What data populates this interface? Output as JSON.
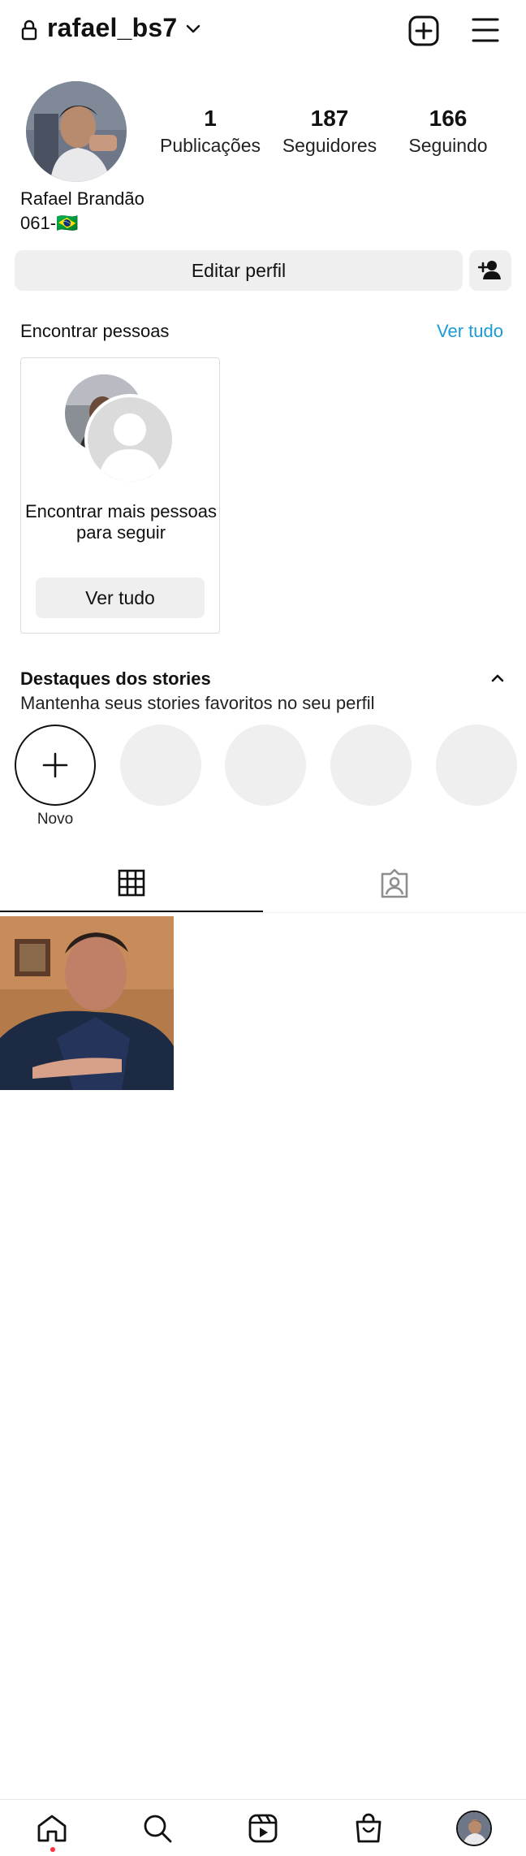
{
  "header": {
    "username": "rafael_bs7",
    "icons": [
      "lock-icon",
      "chevron-down-icon",
      "new-post-icon",
      "menu-icon"
    ]
  },
  "profile": {
    "stats": [
      {
        "value": "1",
        "label": "Publicações"
      },
      {
        "value": "187",
        "label": "Seguidores"
      },
      {
        "value": "166",
        "label": "Seguindo"
      }
    ],
    "full_name": "Rafael Brandão",
    "bio": "061-🇧🇷",
    "edit_label": "Editar perfil"
  },
  "find_people": {
    "title": "Encontrar pessoas",
    "see_all": "Ver tudo",
    "card_text": "Encontrar mais pessoas para seguir",
    "card_button": "Ver tudo"
  },
  "highlights": {
    "title": "Destaques dos stories",
    "subtitle": "Mantenha seus stories favoritos no seu perfil",
    "new_label": "Novo"
  },
  "tabs": [
    "grid-icon",
    "tagged-icon"
  ],
  "nav": [
    "home-icon",
    "search-icon",
    "reels-icon",
    "shop-icon",
    "profile-avatar"
  ]
}
